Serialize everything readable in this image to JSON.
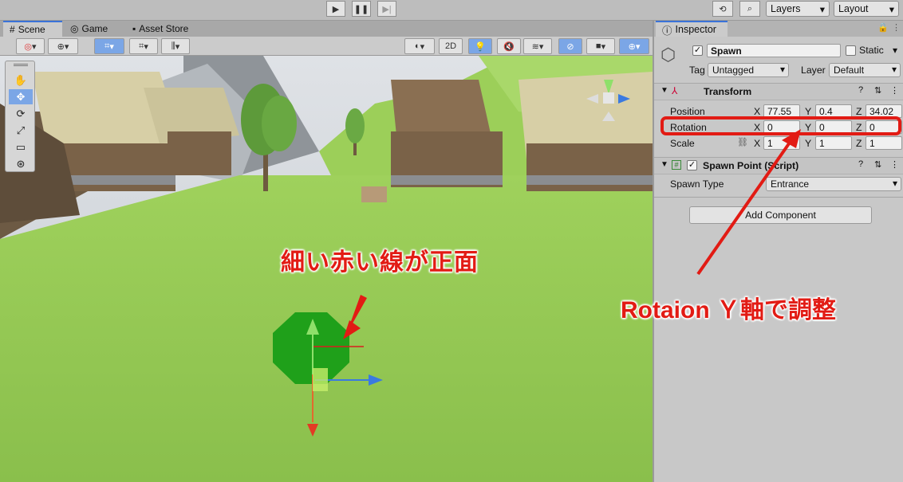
{
  "toolbar": {
    "layers_label": "Layers",
    "layout_label": "Layout"
  },
  "tabs": {
    "scene": "Scene",
    "game": "Game",
    "asset_store": "Asset Store"
  },
  "scene_toolbar": {
    "two_d": "2D"
  },
  "inspector": {
    "tab_label": "Inspector",
    "object_name": "Spawn",
    "static_label": "Static",
    "tag_label": "Tag",
    "tag_value": "Untagged",
    "layer_label": "Layer",
    "layer_value": "Default",
    "transform": {
      "title": "Transform",
      "position_label": "Position",
      "rotation_label": "Rotation",
      "scale_label": "Scale",
      "position": {
        "x": "77.55",
        "y": "0.4",
        "z": "34.02"
      },
      "rotation": {
        "x": "0",
        "y": "0",
        "z": "0"
      },
      "scale": {
        "x": "1",
        "y": "1",
        "z": "1"
      },
      "axis_x": "X",
      "axis_y": "Y",
      "axis_z": "Z"
    },
    "spawn_point": {
      "title": "Spawn Point (Script)",
      "spawn_type_label": "Spawn Type",
      "spawn_type_value": "Entrance"
    },
    "add_component": "Add Component"
  },
  "annotations": {
    "front_note": "細い赤い線が正面",
    "rotation_note": "Rotaion Ｙ軸で調整",
    "color": "#e21b14"
  },
  "colors": {
    "accent": "#3a72d8",
    "highlight": "#7ba6e6",
    "annotation_red": "#e21b14"
  }
}
